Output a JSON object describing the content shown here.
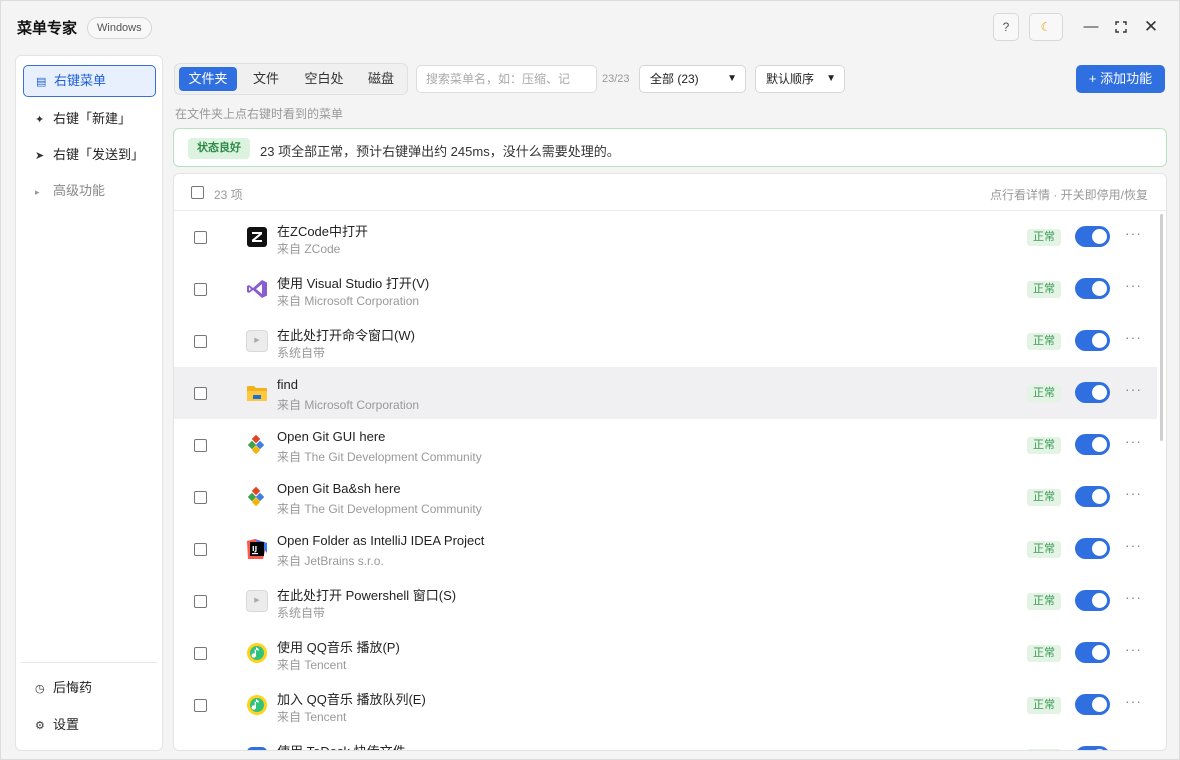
{
  "app": {
    "title": "菜单专家",
    "os_badge": "Windows"
  },
  "titlebar": {
    "help": "?",
    "theme_icon": "moon-icon"
  },
  "sidebar": {
    "items": [
      {
        "label": "右键菜单",
        "icon": "list-icon"
      },
      {
        "label": "右键「新建」",
        "icon": "sparkle-icon"
      },
      {
        "label": "右键「发送到」",
        "icon": "send-icon"
      },
      {
        "label": "高级功能",
        "icon": "triangle-right-icon"
      }
    ],
    "bottom": [
      {
        "label": "后悔药",
        "icon": "clock-icon"
      },
      {
        "label": "设置",
        "icon": "gear-icon"
      }
    ]
  },
  "toolbar": {
    "tabs": [
      "文件夹",
      "文件",
      "空白处",
      "磁盘"
    ],
    "active_tab": "文件夹",
    "search_placeholder": "搜索菜单名，如：压缩、记",
    "count": "23/23",
    "filter": "全部 (23)",
    "order": "默认顺序",
    "add_label": "+ 添加功能"
  },
  "hint": "在文件夹上点右键时看到的菜单",
  "status": {
    "badge": "状态良好",
    "text": "23 项全部正常，预计右键弹出约 245ms，没什么需要处理的。"
  },
  "list": {
    "count_label": "23 项",
    "tip": "点行看详情 · 开关即停用/恢复",
    "status_label": "正常",
    "rows": [
      {
        "title": "在ZCode中打开",
        "sub": "来自 ZCode",
        "icon": "zcode-icon",
        "enabled": true
      },
      {
        "title": "使用 Visual Studio 打开(V)",
        "sub": "来自 Microsoft Corporation",
        "icon": "visual-studio-icon",
        "enabled": true
      },
      {
        "title": "在此处打开命令窗口(W)",
        "sub": "系统自带",
        "icon": "system-icon",
        "enabled": true
      },
      {
        "title": "find",
        "sub": "来自 Microsoft Corporation",
        "icon": "folder-icon",
        "enabled": true
      },
      {
        "title": "Open Git GUI here",
        "sub": "来自 The Git Development Community",
        "icon": "git-icon",
        "enabled": true
      },
      {
        "title": "Open Git Ba&sh here",
        "sub": "来自 The Git Development Community",
        "icon": "git-icon",
        "enabled": true
      },
      {
        "title": "Open Folder as IntelliJ IDEA Project",
        "sub": "来自 JetBrains s.r.o.",
        "icon": "intellij-icon",
        "enabled": true
      },
      {
        "title": "在此处打开 Powershell 窗口(S)",
        "sub": "系统自带",
        "icon": "system-icon",
        "enabled": true
      },
      {
        "title": "使用 QQ音乐 播放(P)",
        "sub": "来自 Tencent",
        "icon": "qqmusic-icon",
        "enabled": true
      },
      {
        "title": "加入 QQ音乐 播放队列(E)",
        "sub": "来自 Tencent",
        "icon": "qqmusic-icon",
        "enabled": true
      },
      {
        "title": "使用 ToDesk 快传文件",
        "sub": "",
        "icon": "todesk-icon",
        "enabled": true
      }
    ]
  },
  "colors": {
    "accent": "#2f6fe0",
    "ok_green": "#3a9a55",
    "ok_bg": "#e3f4e5"
  }
}
